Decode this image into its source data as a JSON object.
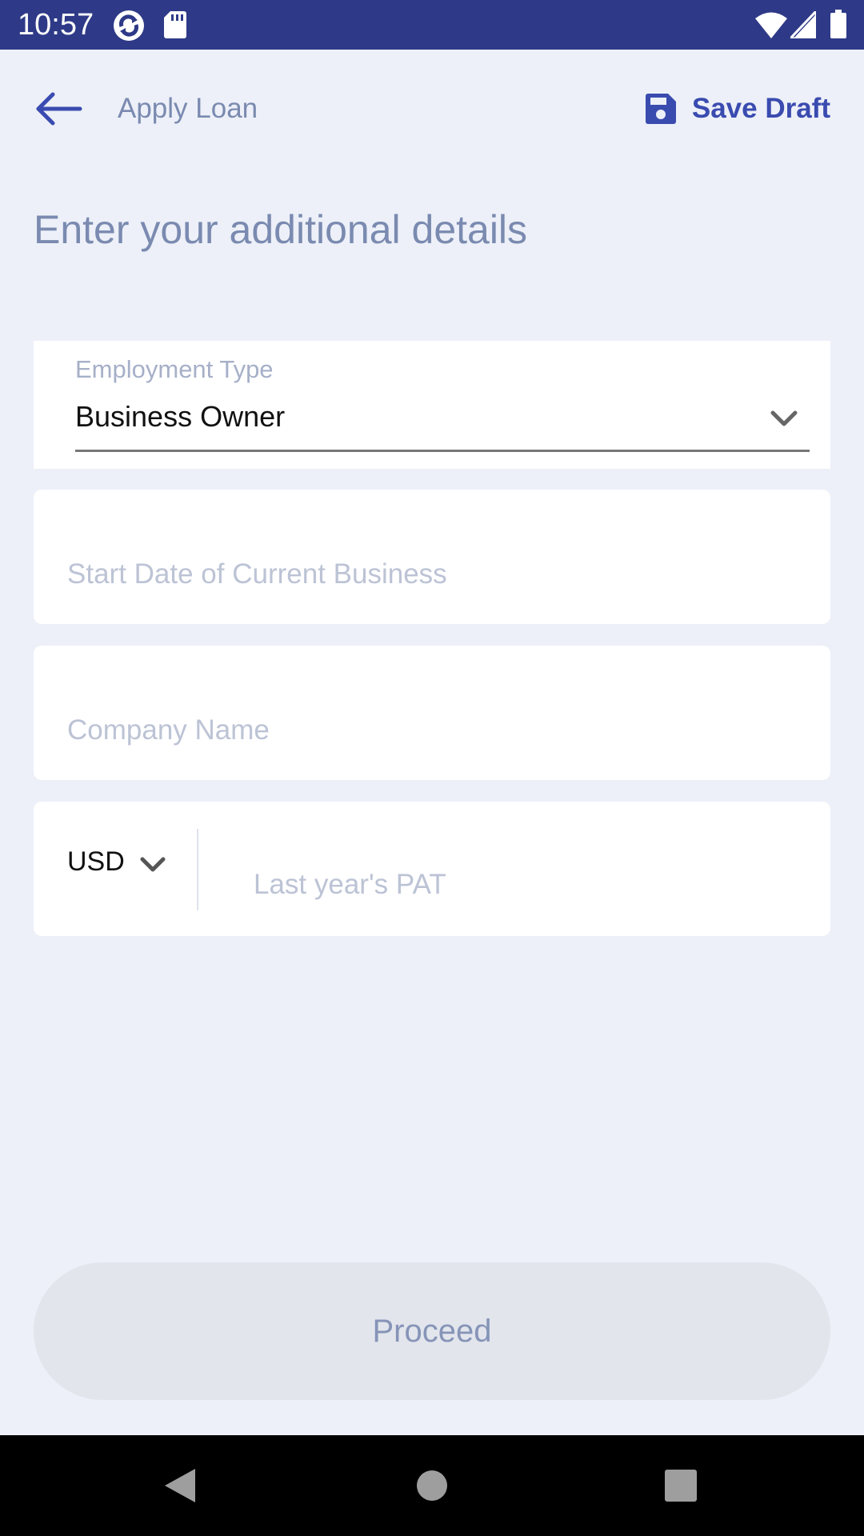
{
  "status_bar": {
    "time": "10:57",
    "icons": [
      "sync-icon",
      "sd-card-icon",
      "wifi-icon",
      "signal-icon",
      "battery-icon"
    ],
    "background": "#2e3a87"
  },
  "header": {
    "title": "Apply Loan",
    "save_label": "Save Draft",
    "back_icon": "arrow-left-icon",
    "save_icon": "floppy-disk-icon",
    "accent_color": "#3a4bb0"
  },
  "page_title": "Enter your additional details",
  "form": {
    "employment_type": {
      "label": "Employment Type",
      "value": "Business Owner"
    },
    "start_date": {
      "placeholder": "Start Date of Current Business"
    },
    "company_name": {
      "placeholder": "Company Name"
    },
    "pat": {
      "currency": "USD",
      "placeholder": "Last year's PAT"
    }
  },
  "proceed": {
    "label": "Proceed",
    "state": "disabled"
  },
  "nav_bar": {
    "buttons": [
      "back-triangle-icon",
      "home-circle-icon",
      "recents-square-icon"
    ]
  }
}
